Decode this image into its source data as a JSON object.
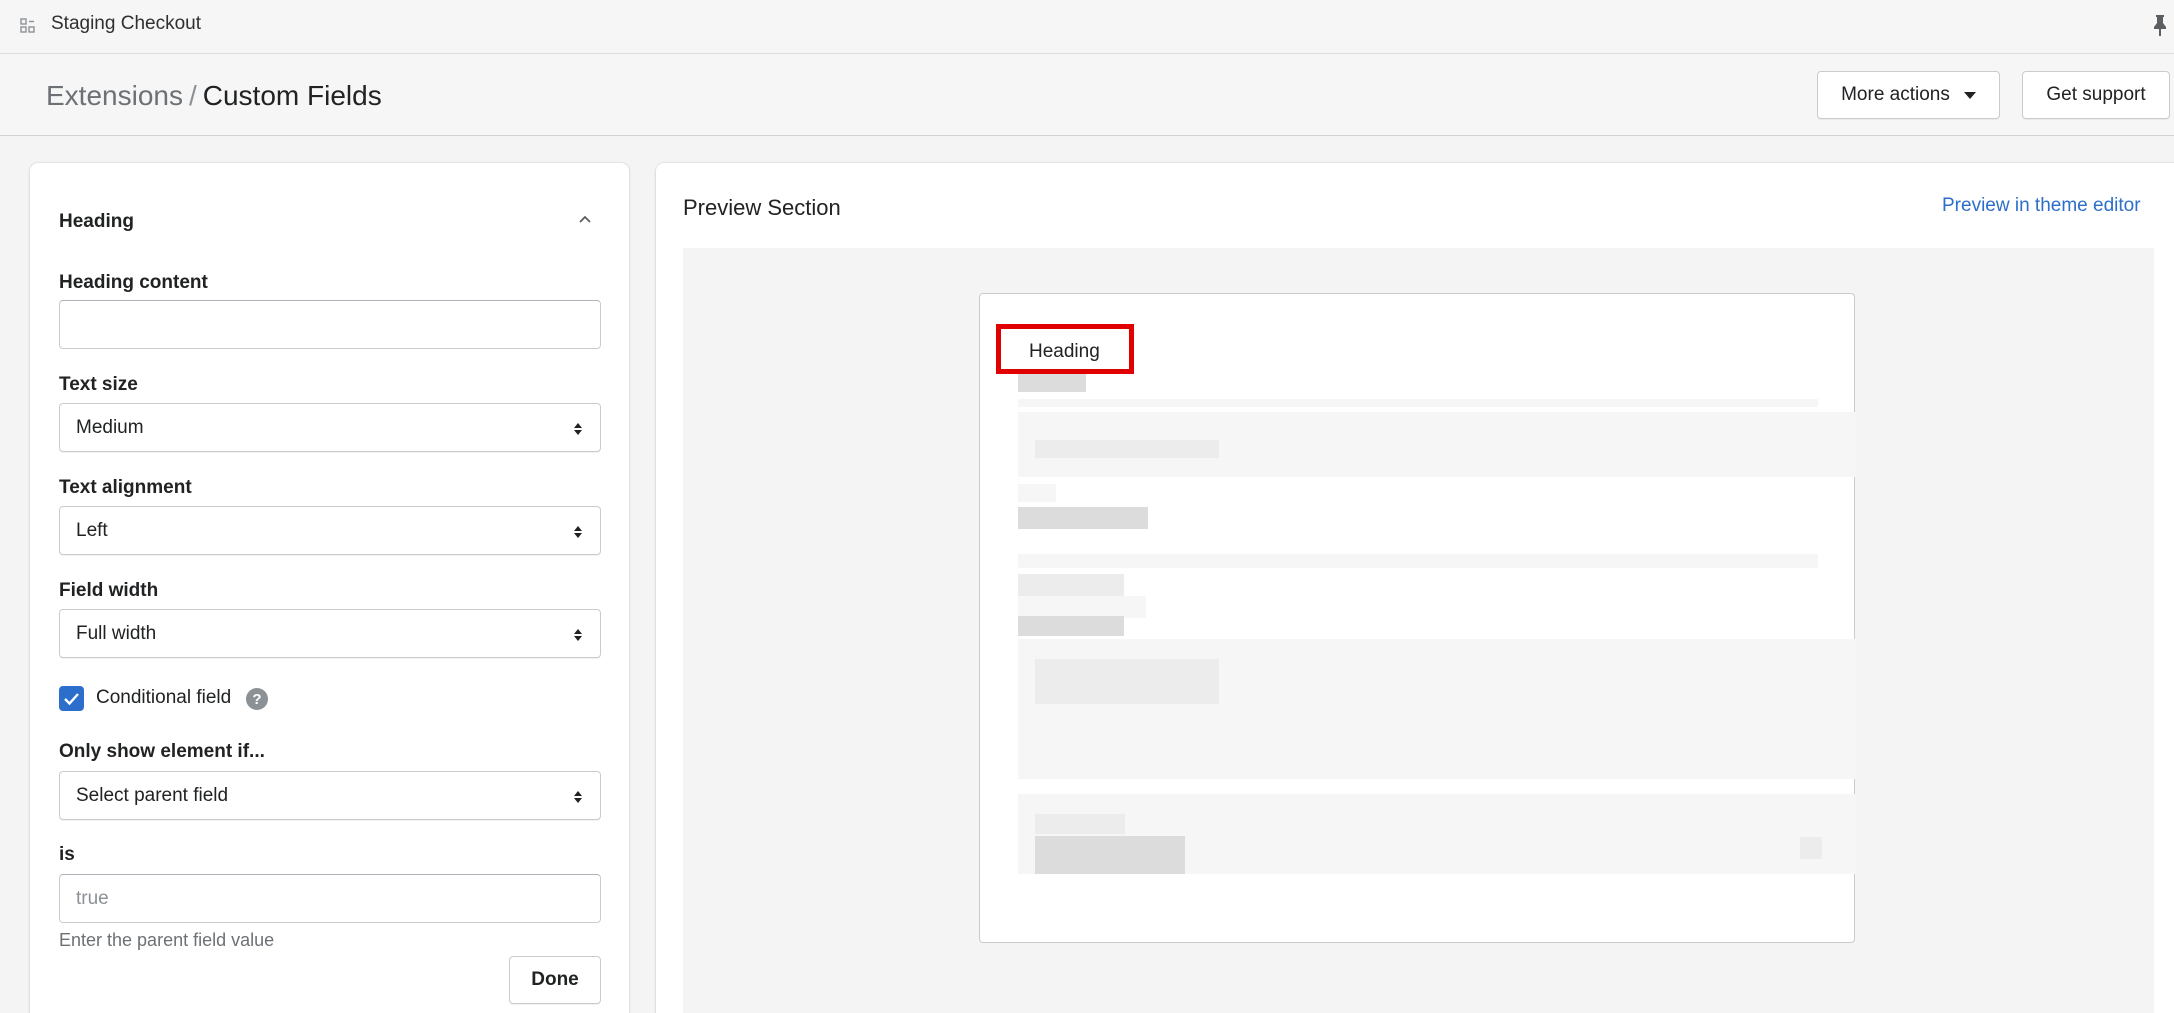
{
  "topbar": {
    "app_title": "Staging Checkout",
    "app_icon": "apps-icon",
    "pin_icon": "pin-icon"
  },
  "header": {
    "breadcrumb_parent": "Extensions",
    "breadcrumb_separator": "/",
    "breadcrumb_current": "Custom Fields",
    "more_actions_label": "More actions",
    "support_label": "Get support"
  },
  "editor": {
    "section_title": "Heading",
    "heading_content": {
      "label": "Heading content",
      "value": ""
    },
    "text_size": {
      "label": "Text size",
      "value": "Medium"
    },
    "text_alignment": {
      "label": "Text alignment",
      "value": "Left"
    },
    "field_width": {
      "label": "Field width",
      "value": "Full width"
    },
    "conditional": {
      "label": "Conditional field",
      "checked": true
    },
    "only_show": {
      "label": "Only show element if...",
      "value": "Select parent field"
    },
    "is_field": {
      "label": "is",
      "placeholder": "true",
      "help": "Enter the parent field value"
    },
    "done_label": "Done"
  },
  "preview": {
    "title": "Preview Section",
    "link_label": "Preview in theme editor",
    "heading_text": "Heading"
  },
  "colors": {
    "accent": "#2c6ecb",
    "highlight": "#e00000"
  }
}
